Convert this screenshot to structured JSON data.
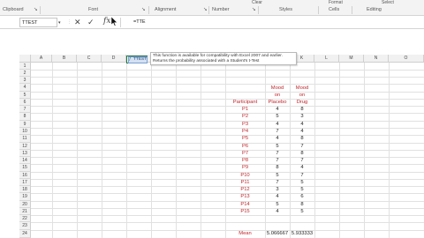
{
  "ribbon": {
    "groups": [
      "Clipboard",
      "Font",
      "Alignment",
      "Number",
      "Styles",
      "Cells",
      "Editing"
    ],
    "top_items": [
      "Format",
      "Clear",
      "Select"
    ]
  },
  "formula_bar": {
    "name_box": "TTEST",
    "cancel_symbol": "✕",
    "enter_symbol": "✓",
    "fx_label": "fx",
    "formula": "=TTE"
  },
  "autocomplete": {
    "item": "TTEST",
    "tooltip_line1": "This function is available for compatibility with Excel 2007 and earlier.",
    "tooltip_line2": "Returns the probability associated with a Student's t-Test"
  },
  "columns": [
    "A",
    "B",
    "C",
    "D",
    "E",
    "F",
    "G",
    "H",
    "I",
    "J",
    "K",
    "L",
    "M",
    "N",
    "O"
  ],
  "rows": [
    "1",
    "2",
    "3",
    "4",
    "5",
    "6",
    "7",
    "8",
    "9",
    "10",
    "11",
    "12",
    "13",
    "14",
    "15",
    "16",
    "17",
    "18",
    "19",
    "20",
    "21",
    "22",
    "23",
    "24"
  ],
  "table": {
    "header_placebo": [
      "Mood",
      "on",
      "Placebo"
    ],
    "header_drug": [
      "Mood",
      "on",
      "Drug"
    ],
    "header_participant": "Participant",
    "participants": [
      "P1",
      "P2",
      "P3",
      "P4",
      "P5",
      "P6",
      "P7",
      "P8",
      "P9",
      "P10",
      "P11",
      "P12",
      "P13",
      "P14",
      "P15"
    ],
    "placebo": [
      "4",
      "5",
      "4",
      "7",
      "4",
      "5",
      "7",
      "7",
      "8",
      "5",
      "7",
      "3",
      "4",
      "5",
      "4"
    ],
    "drug": [
      "8",
      "3",
      "4",
      "4",
      "8",
      "7",
      "8",
      "7",
      "4",
      "7",
      "5",
      "5",
      "6",
      "8",
      "5"
    ],
    "mean_label": "Mean",
    "mean_placebo": "5.066667",
    "mean_drug": "5.933333"
  },
  "colors": {
    "accent_red": "#c0262c",
    "excel_green": "#217346"
  }
}
